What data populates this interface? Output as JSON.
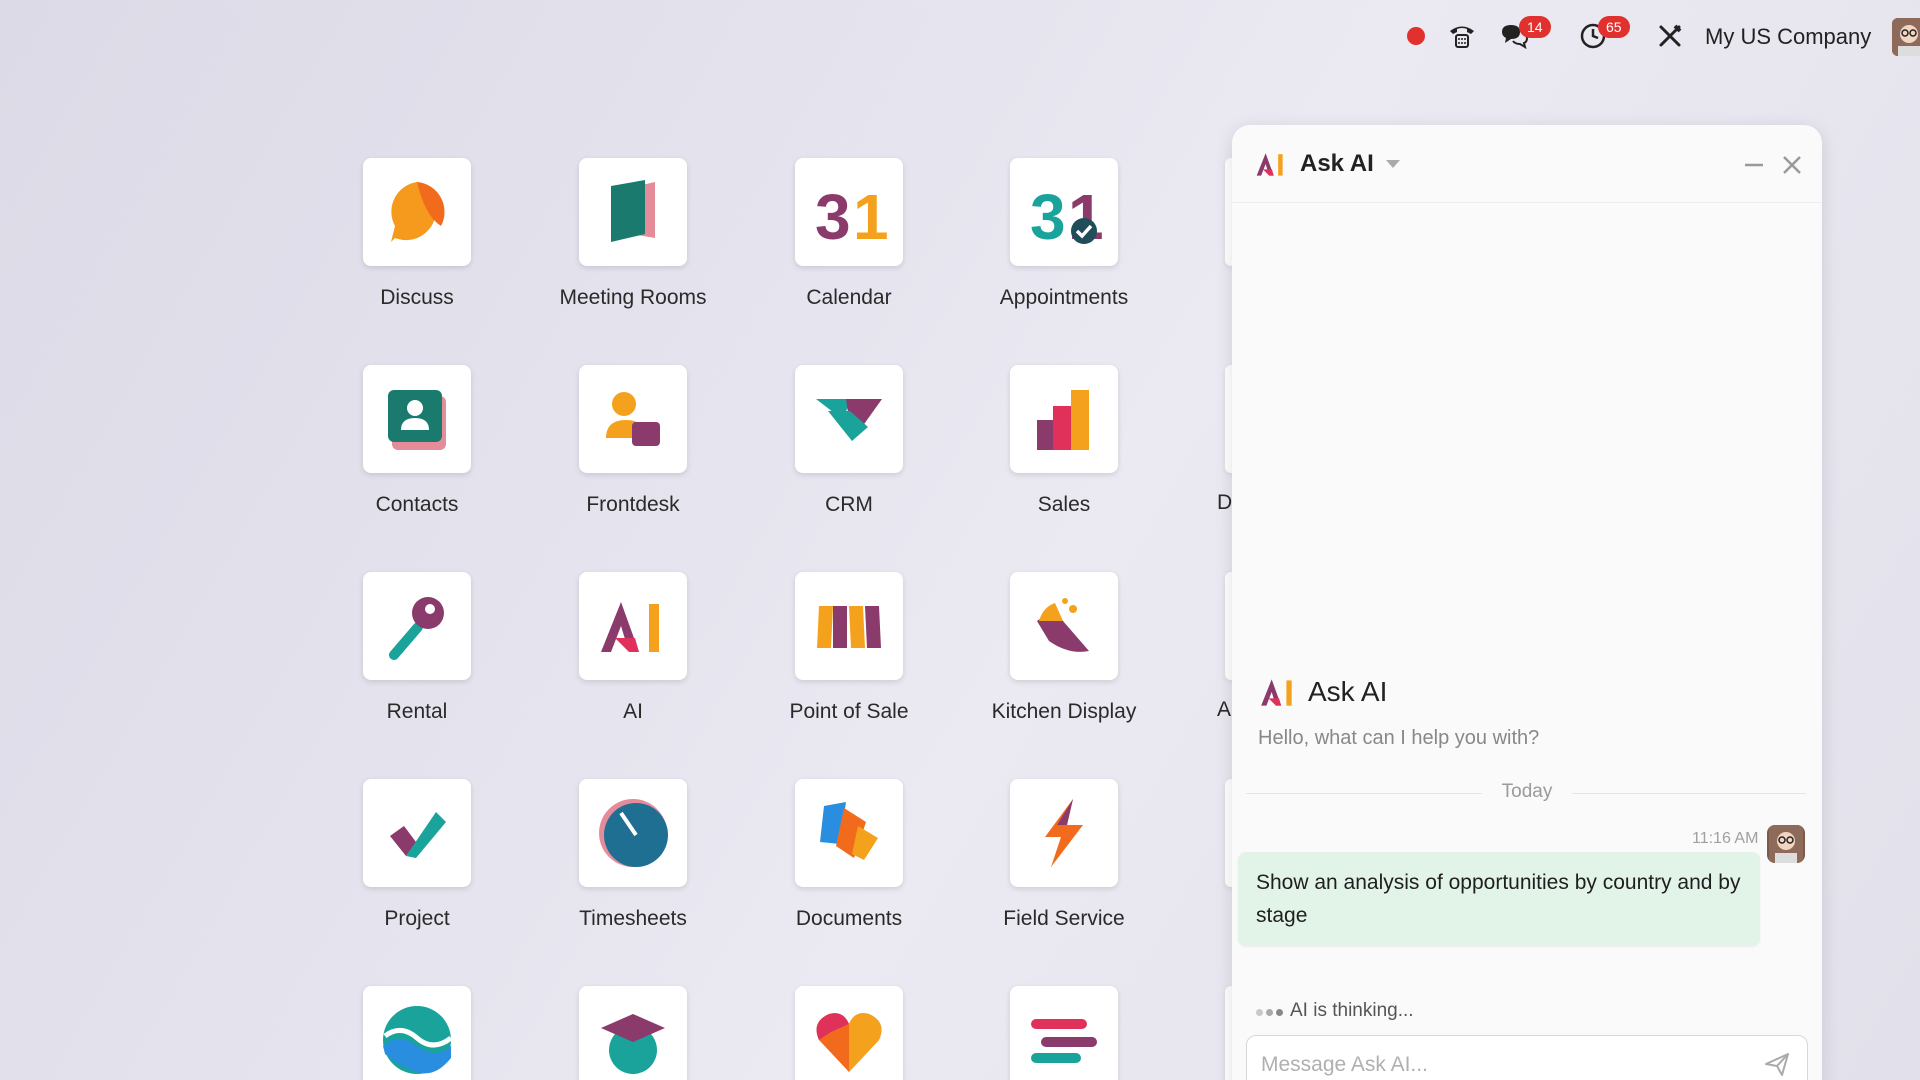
{
  "topbar": {
    "chat_badge": "14",
    "activity_badge": "65",
    "company": "My US Company"
  },
  "apps": [
    {
      "label": "Discuss",
      "icon": "discuss-icon"
    },
    {
      "label": "Meeting Rooms",
      "icon": "meeting-rooms-icon"
    },
    {
      "label": "Calendar",
      "icon": "calendar-icon",
      "number": "31"
    },
    {
      "label": "Appointments",
      "icon": "appointments-icon",
      "number": "31"
    },
    {
      "label": "Contacts",
      "icon": "contacts-icon"
    },
    {
      "label": "Frontdesk",
      "icon": "frontdesk-icon"
    },
    {
      "label": "CRM",
      "icon": "crm-icon"
    },
    {
      "label": "Sales",
      "icon": "sales-icon"
    },
    {
      "label": "Rental",
      "icon": "rental-icon"
    },
    {
      "label": "AI",
      "icon": "ai-icon"
    },
    {
      "label": "Point of Sale",
      "icon": "point-of-sale-icon"
    },
    {
      "label": "Kitchen Display",
      "icon": "kitchen-display-icon"
    },
    {
      "label": "Project",
      "icon": "project-icon"
    },
    {
      "label": "Timesheets",
      "icon": "timesheets-icon"
    },
    {
      "label": "Documents",
      "icon": "documents-icon"
    },
    {
      "label": "Field Service",
      "icon": "field-service-icon"
    }
  ],
  "clipped_labels": [
    "D",
    "A"
  ],
  "chat": {
    "title": "Ask AI",
    "intro_name": "Ask AI",
    "intro_text": "Hello, what can I help you with?",
    "divider": "Today",
    "message_time": "11:16 AM",
    "message": "Show an analysis of opportunities by country and by stage",
    "thinking": "AI is thinking...",
    "input_placeholder": "Message Ask AI..."
  },
  "colors": {
    "badge_red": "#e0312f",
    "bubble_green": "#e2f3e7",
    "brand_purple": "#8a3a6b",
    "brand_orange": "#f4a21d",
    "brand_teal": "#1aa39a"
  }
}
